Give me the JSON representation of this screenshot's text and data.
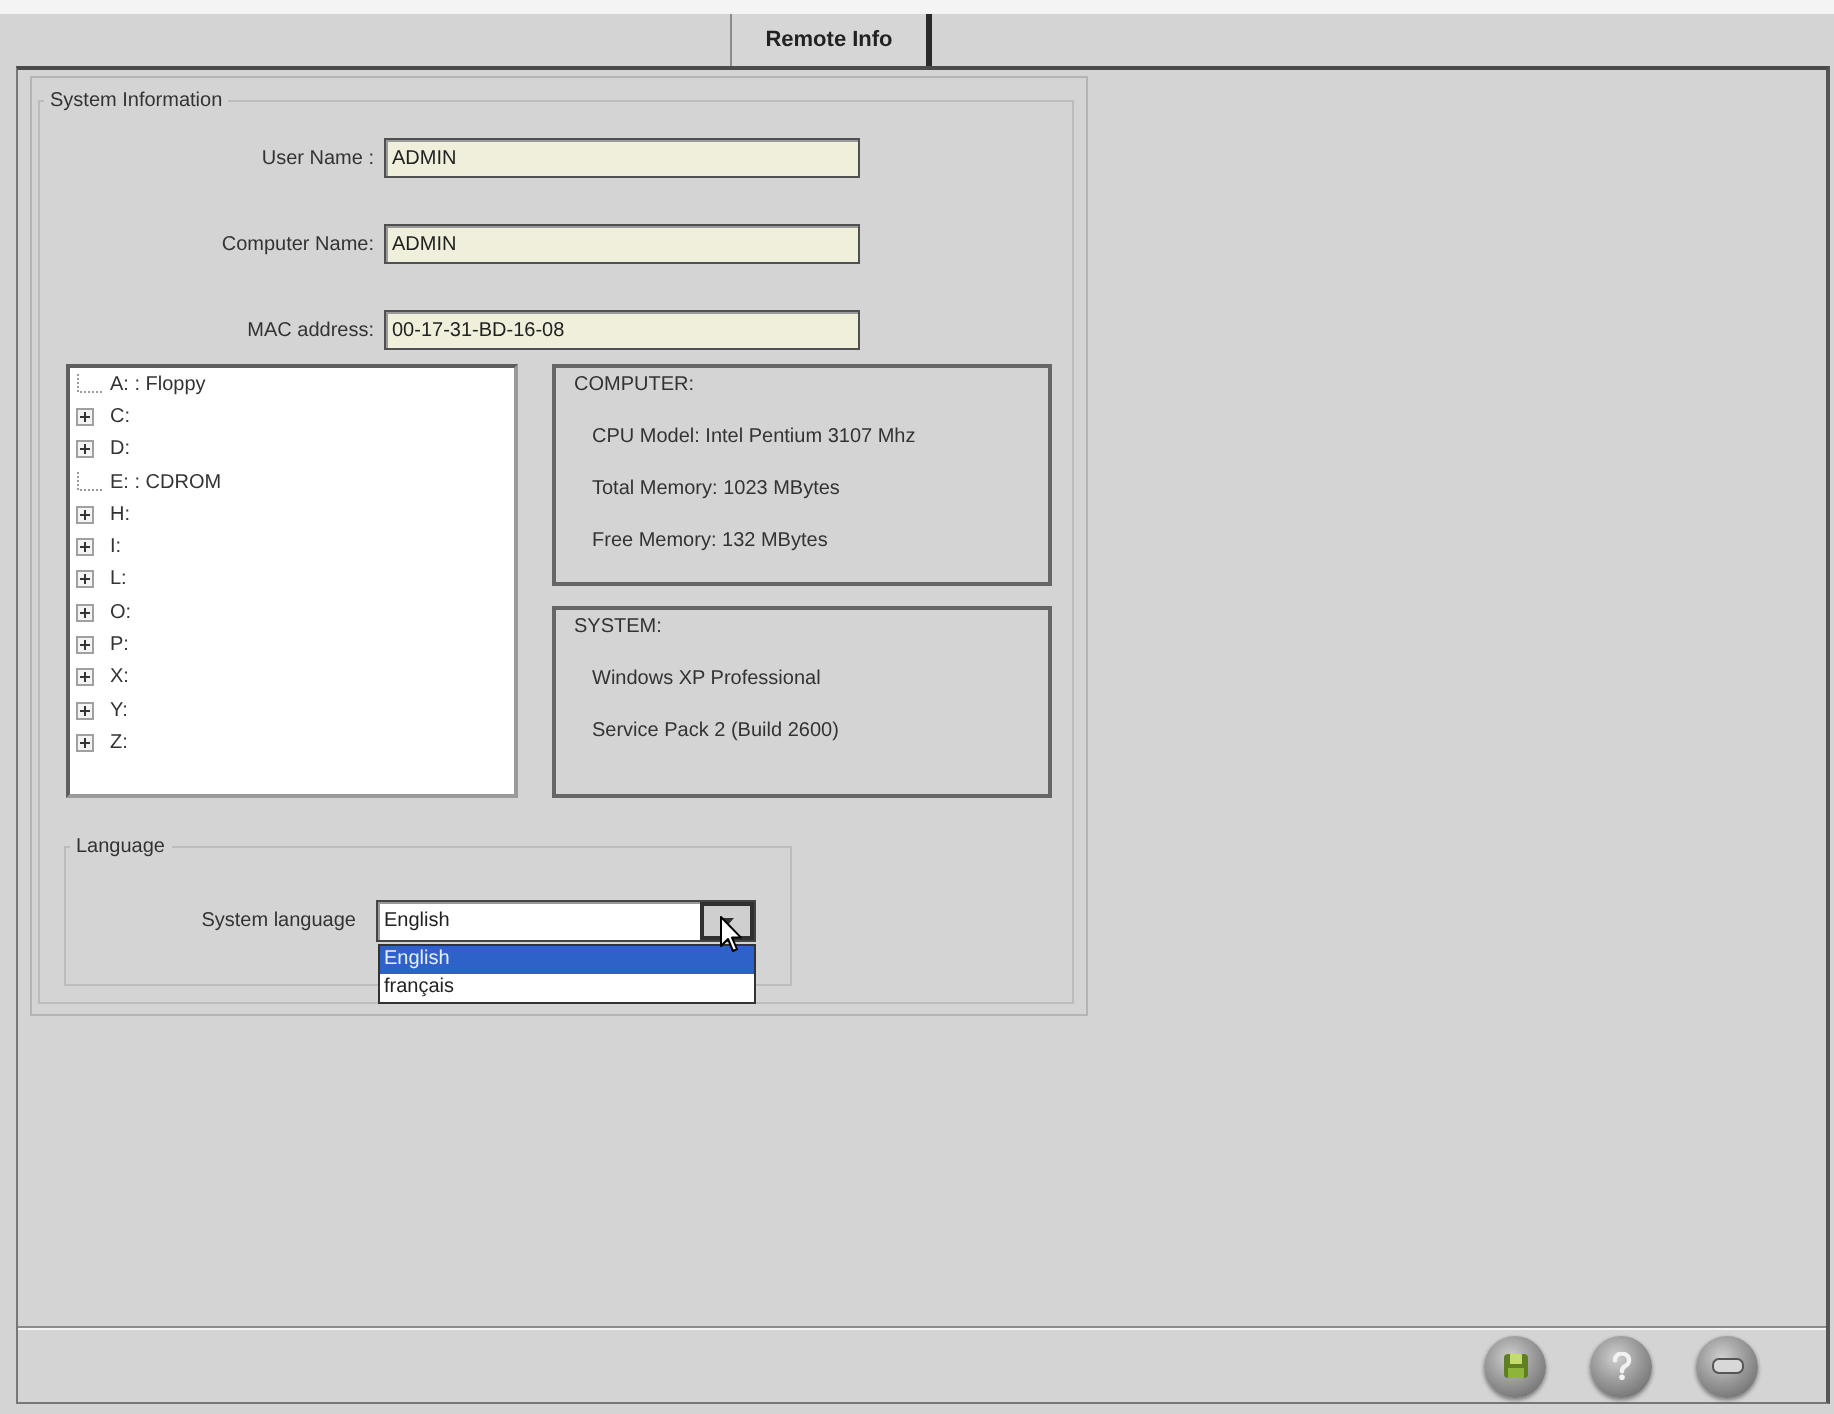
{
  "tabs": [
    {
      "label": "Remote Info",
      "selected": true
    }
  ],
  "system_information": {
    "title": "System Information",
    "fields": [
      {
        "label": "User Name :",
        "value": "ADMIN"
      },
      {
        "label": "Computer Name:",
        "value": "ADMIN"
      },
      {
        "label": "MAC address:",
        "value": "00-17-31-BD-16-08"
      }
    ],
    "drives": [
      {
        "label": "A: : Floppy",
        "expandable": false
      },
      {
        "label": "C:",
        "expandable": true
      },
      {
        "label": "D:",
        "expandable": true
      },
      {
        "label": "E: : CDROM",
        "expandable": false
      },
      {
        "label": "H:",
        "expandable": true
      },
      {
        "label": "I:",
        "expandable": true
      },
      {
        "label": "L:",
        "expandable": true
      },
      {
        "label": "O:",
        "expandable": true
      },
      {
        "label": "P:",
        "expandable": true
      },
      {
        "label": "X:",
        "expandable": true
      },
      {
        "label": "Y:",
        "expandable": true
      },
      {
        "label": "Z:",
        "expandable": true
      }
    ],
    "computer": {
      "title": "COMPUTER:",
      "lines": [
        "CPU Model: Intel Pentium 3107 Mhz",
        "Total Memory: 1023 MBytes",
        "Free Memory: 132 MBytes"
      ]
    },
    "system": {
      "title": "SYSTEM:",
      "lines": [
        "Windows XP Professional",
        "Service Pack 2 (Build 2600)"
      ]
    },
    "language": {
      "title": "Language",
      "label": "System language",
      "value": "English",
      "options": [
        {
          "label": "English",
          "selected": true
        },
        {
          "label": "français",
          "selected": false
        }
      ]
    }
  },
  "buttons": [
    {
      "kind": "disk"
    },
    {
      "kind": "help"
    },
    {
      "kind": "minus"
    }
  ]
}
